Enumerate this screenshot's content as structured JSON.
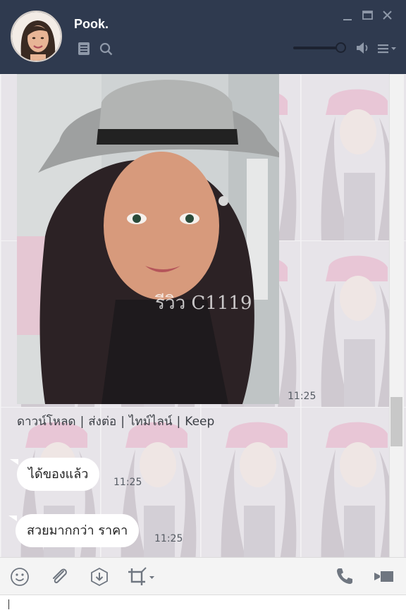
{
  "header": {
    "title": "Pook.",
    "icons": [
      "notes-icon",
      "search-icon",
      "minimize-icon",
      "maximize-icon",
      "close-icon",
      "volume-icon",
      "menu-icon"
    ],
    "volume_level": 0.9,
    "colors": {
      "background": "#2f3a4f",
      "title": "#ffffff"
    }
  },
  "chat": {
    "photo": {
      "watermark": "รีวิว C1119",
      "time": "11:25"
    },
    "photo_actions": {
      "download": "ดาวน์โหลด",
      "forward": "ส่งต่อ",
      "timeline": "ไทม์ไลน์",
      "keep": "Keep",
      "separator": "|"
    },
    "messages": [
      {
        "text": "ได้ของแล้ว",
        "time": "11:25"
      },
      {
        "text": "สวยมากกว่า ราคา",
        "time": "11:25"
      }
    ]
  },
  "toolbar": {
    "icons": [
      "emoji-icon",
      "attach-icon",
      "save-icon",
      "crop-icon",
      "call-icon",
      "video-call-icon"
    ]
  }
}
